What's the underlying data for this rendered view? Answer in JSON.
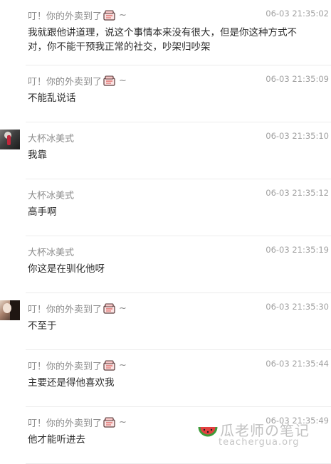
{
  "messages": [
    {
      "author": "叮！你的外卖到了",
      "suffix": "~",
      "has_takeout_icon": true,
      "avatar": "none",
      "time": "06-03 21:35:02",
      "lines": [
        "我就跟他讲道理，说这个事情本来没有很大，但是你这种方式不",
        "对，你不能干预我正常的社交，吵架归吵架"
      ]
    },
    {
      "author": "叮！你的外卖到了",
      "suffix": "~",
      "has_takeout_icon": true,
      "avatar": "none",
      "time": "06-03 21:35:09",
      "lines": [
        "不能乱说话"
      ]
    },
    {
      "author": "大杯冰美式",
      "suffix": "",
      "has_takeout_icon": false,
      "avatar": "ice",
      "time": "06-03 21:35:10",
      "lines": [
        "我靠"
      ]
    },
    {
      "author": "大杯冰美式",
      "suffix": "",
      "has_takeout_icon": false,
      "avatar": "none",
      "time": "06-03 21:35:12",
      "lines": [
        "高手啊"
      ]
    },
    {
      "author": "大杯冰美式",
      "suffix": "",
      "has_takeout_icon": false,
      "avatar": "none",
      "time": "06-03 21:35:19",
      "lines": [
        "你这是在驯化他呀"
      ]
    },
    {
      "author": "叮！你的外卖到了",
      "suffix": "~",
      "has_takeout_icon": true,
      "avatar": "takeout",
      "time": "06-03 21:35:30",
      "lines": [
        "不至于"
      ]
    },
    {
      "author": "叮！你的外卖到了",
      "suffix": "~",
      "has_takeout_icon": true,
      "avatar": "none",
      "time": "06-03 21:35:44",
      "lines": [
        "主要还是得他喜欢我"
      ]
    },
    {
      "author": "叮！你的外卖到了",
      "suffix": "~",
      "has_takeout_icon": true,
      "avatar": "none",
      "time": "06-03 21:35:49",
      "lines": [
        "他才能听进去"
      ]
    }
  ],
  "watermark": {
    "title": "瓜老师の笔记",
    "site": "teachergua.org",
    "icon": "watermelon-icon"
  },
  "colors": {
    "author": "#8c8c8c",
    "time": "#a0a0a0",
    "content": "#2b2b2b",
    "divider": "#ececec"
  }
}
